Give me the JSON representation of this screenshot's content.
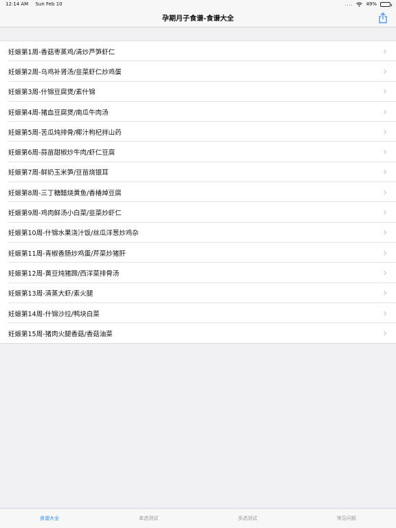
{
  "status": {
    "time": "12:14 AM",
    "date": "Sun Feb 10",
    "signal": "....",
    "battery_percent": "49%",
    "battery_level": 0.49
  },
  "nav": {
    "title": "孕期月子食谱-食谱大全",
    "share_icon": "share-icon"
  },
  "items": [
    "妊娠第1周-香菇枣蒸鸡/清炒芦笋虾仁",
    "妊娠第2周-乌鸡补肾汤/韭菜虾仁炒鸡蛋",
    "妊娠第3周-什锦豆腐煲/素什锦",
    "妊娠第4周-猪血豆腐煲/南瓜牛肉汤",
    "妊娠第5周-苦瓜炖排骨/椰汁枸杞拌山药",
    "妊娠第6周-蒜苗甜椒炒牛肉/虾仁豆腐",
    "妊娠第7周-鲜奶玉米笋/豆苗烧银耳",
    "妊娠第8周-三丁糖醋烧黄鱼/香椿焯豆腐",
    "妊娠第9周-鸡肉鲜汤小白菜/韭菜炒虾仁",
    "妊娠第10周-什锦水果浇汁饭/丝瓜洋葱炒鸡杂",
    "妊娠第11周-青椒香肠炒鸡蛋/芹菜炒猪肝",
    "妊娠第12周-黄豆炖猪蹄/西洋菜排骨汤",
    "妊娠第13周-清蒸大虾/素火腿",
    "妊娠第14周-什锦沙拉/鸭块白菜",
    "妊娠第15周-猪肉火腿香菇/香菇油菜"
  ],
  "tabs": [
    {
      "label": "食谱大全",
      "active": true
    },
    {
      "label": "单选测试",
      "active": false
    },
    {
      "label": "多选测试",
      "active": false
    },
    {
      "label": "常见问题",
      "active": false
    }
  ],
  "colors": {
    "accent": "#2f8cf4",
    "background": "#efeff4"
  }
}
